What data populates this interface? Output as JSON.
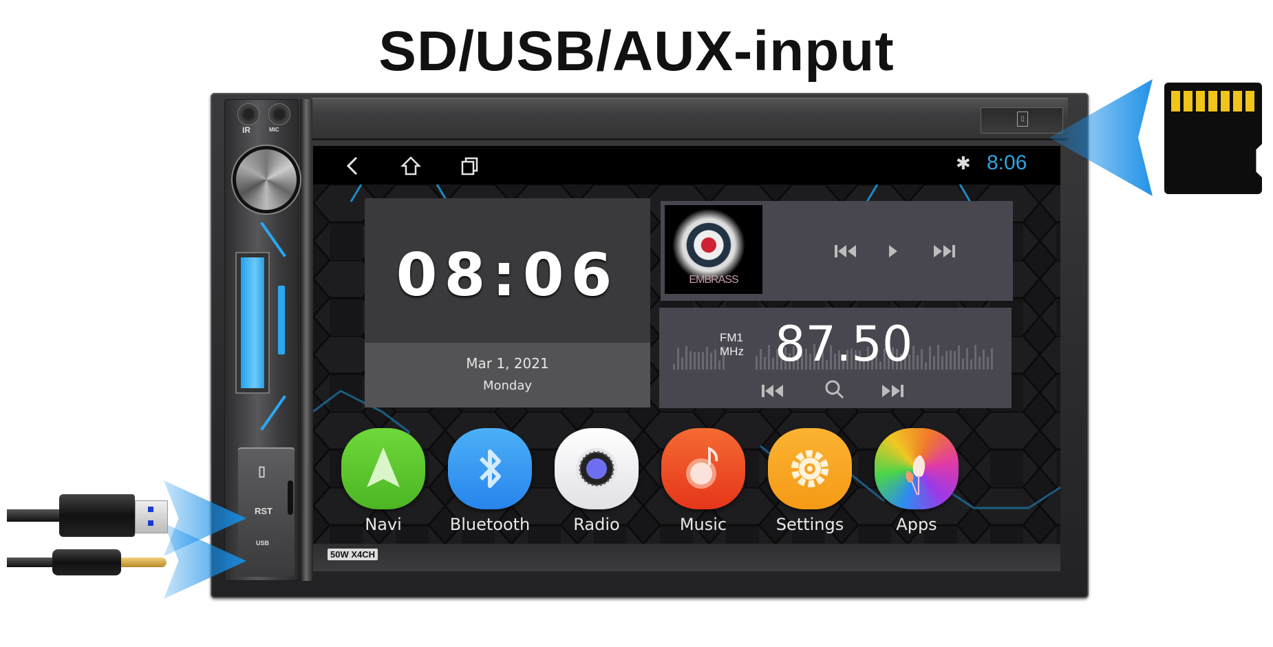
{
  "title": "SD/USB/AUX-input",
  "side_panel": {
    "ir_label": "IR",
    "mic_label": "MIC",
    "rst_label": "RST",
    "usb_label": "USB"
  },
  "status_bar": {
    "nav_back_icon": "back-arrow-icon",
    "nav_home_icon": "home-icon",
    "nav_recents_icon": "recent-apps-icon",
    "bluetooth_icon": "bluetooth-icon",
    "time": "8:06",
    "time_color": "#2fa4e0"
  },
  "clock_widget": {
    "time": "08:06",
    "date": "Mar 1, 2021",
    "day": "Monday"
  },
  "music_widget": {
    "album_text": "EMBRASS",
    "prev_icon": "previous-track-icon",
    "play_icon": "play-icon",
    "next_icon": "next-track-icon"
  },
  "radio_widget": {
    "band": "FM1",
    "unit": "MHz",
    "frequency": "87.50",
    "prev_icon": "seek-back-icon",
    "search_icon": "search-icon",
    "next_icon": "seek-forward-icon"
  },
  "apps": [
    {
      "label": "Navi",
      "icon": "navigation-arrow-icon",
      "color": "#5cc62f"
    },
    {
      "label": "Bluetooth",
      "icon": "bluetooth-icon",
      "color": "#2e97f0"
    },
    {
      "label": "Radio",
      "icon": "radio-dial-icon",
      "color": "#f2f2f4"
    },
    {
      "label": "Music",
      "icon": "music-note-icon",
      "color": "#ee4a22"
    },
    {
      "label": "Settings",
      "icon": "gear-icon",
      "color": "#f8a623"
    },
    {
      "label": "Apps",
      "icon": "tulip-icon",
      "color": "#c94be0"
    }
  ],
  "power_badge": "50W X4CH",
  "accessories": {
    "sd_card": "micro-sd-card",
    "usb": "usb-a-plug",
    "aux": "3.5mm-aux-plug"
  },
  "accent_color": "#1f96eb"
}
